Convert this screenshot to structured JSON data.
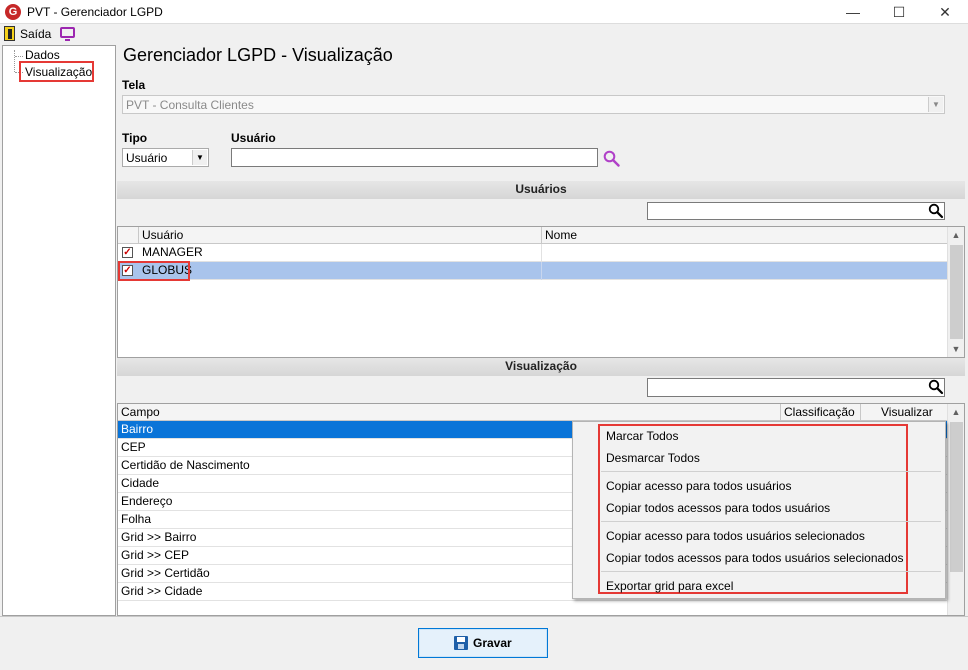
{
  "window": {
    "title": "PVT - Gerenciador LGPD",
    "minimize_glyph": "—",
    "maximize_glyph": "☐",
    "close_glyph": "✕"
  },
  "toolbar": {
    "exit_label": "Saída"
  },
  "tree": {
    "items": [
      {
        "label": "Dados"
      },
      {
        "label": "Visualização"
      }
    ]
  },
  "page": {
    "title": "Gerenciador LGPD - Visualização"
  },
  "form": {
    "tela_label": "Tela",
    "tela_value": "PVT - Consulta Clientes",
    "tipo_label": "Tipo",
    "tipo_value": "Usuário",
    "usuario_label": "Usuário",
    "usuario_value": ""
  },
  "usuarios": {
    "section_title": "Usuários",
    "filter_value": "",
    "columns": [
      "Usuário",
      "Nome"
    ],
    "rows": [
      {
        "usuario": "MANAGER",
        "nome": "",
        "checked": true
      },
      {
        "usuario": "GLOBUS",
        "nome": "",
        "checked": true
      }
    ]
  },
  "visualizacao": {
    "section_title": "Visualização",
    "filter_value": "",
    "columns": [
      "Campo",
      "Classificação",
      "Visualizar"
    ],
    "rows": [
      {
        "campo": "Bairro"
      },
      {
        "campo": "CEP"
      },
      {
        "campo": "Certidão de Nascimento"
      },
      {
        "campo": "Cidade"
      },
      {
        "campo": "Endereço"
      },
      {
        "campo": "Folha"
      },
      {
        "campo": "Grid >> Bairro"
      },
      {
        "campo": "Grid >> CEP"
      },
      {
        "campo": "Grid >> Certidão"
      },
      {
        "campo": "Grid >> Cidade"
      }
    ]
  },
  "context_menu": {
    "items": [
      "Marcar Todos",
      "Desmarcar Todos",
      "Copiar acesso para todos usuários",
      "Copiar todos acessos para todos usuários",
      "Copiar acesso para todos usuários selecionados",
      "Copiar todos acessos para todos usuários selecionados",
      "Exportar grid para excel"
    ]
  },
  "footer": {
    "save_label": "Gravar"
  },
  "colors": {
    "highlight_red": "#e53935",
    "selection_blue": "#0a74d8",
    "row_selected": "#a9c4ec",
    "accent_purple": "#9c27b0"
  }
}
